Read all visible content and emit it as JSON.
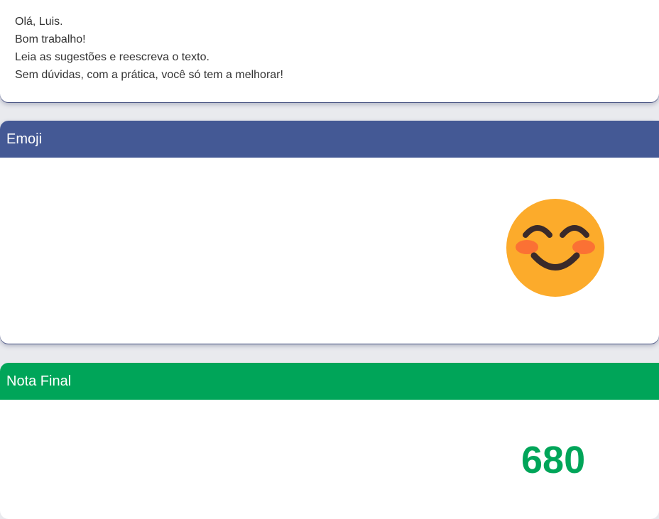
{
  "feedback": {
    "lines": [
      "Olá, Luis.",
      "Bom trabalho!",
      "Leia as sugestões e reescreva o texto.",
      "Sem dúvidas, com a prática, você só tem a melhorar!"
    ]
  },
  "emoji_section": {
    "title": "Emoji",
    "icon": "smiling-face-with-smiling-eyes-icon",
    "header_color": "#445995",
    "face_color": "#fcab2b"
  },
  "grade_section": {
    "title": "Nota Final",
    "value": "680",
    "header_color": "#00a559"
  }
}
